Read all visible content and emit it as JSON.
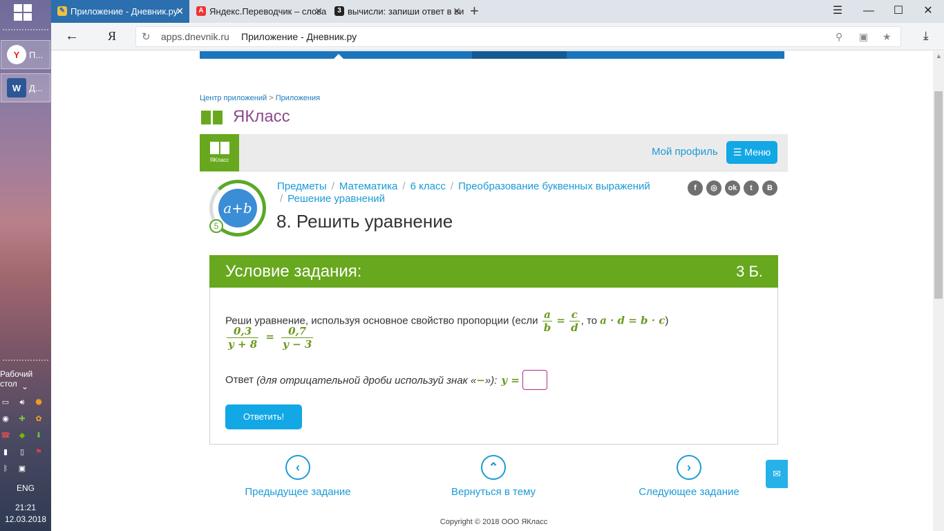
{
  "taskbar": {
    "apps": [
      {
        "label": "П...",
        "icon": "yandex-browser-icon"
      },
      {
        "label": "Д...",
        "icon": "word-icon"
      }
    ],
    "desktop_label": "Рабочий стол",
    "language": "ENG",
    "time": "21:21",
    "date": "12.03.2018"
  },
  "browser": {
    "tabs": [
      {
        "title": "Приложение - Дневник.ру",
        "icon": "dnevnik-icon",
        "active": true
      },
      {
        "title": "Яндекс.Переводчик – слова",
        "icon": "yandex-translate-icon",
        "active": false
      },
      {
        "title": "вычисли: запиши ответ в ви",
        "icon": "znanija-icon",
        "active": false
      }
    ],
    "url_host": "apps.dnevnik.ru",
    "url_title": "Приложение - Дневник.ру",
    "yandex_button": "Я"
  },
  "page": {
    "breadcrumb_top": [
      "Центр приложений",
      "Приложения"
    ],
    "brand_name": "ЯКласс",
    "logo_label": "ЯКласс",
    "my_profile": "Мой профиль",
    "menu_label": "☰ Меню",
    "topic_formula": "a+b",
    "topic_level": "5",
    "crumbs": [
      "Предметы",
      "Математика",
      "6 класс",
      "Преобразование буквенных выражений",
      "Решение уравнений"
    ],
    "title": "8. Решить уравнение",
    "social": [
      "f",
      "◎",
      "ok",
      "t",
      "B"
    ],
    "task": {
      "header": "Условие задания:",
      "points": "3 Б.",
      "text_before": "Реши уравнение, используя основное свойство пропорции (если",
      "frac1_num": "a",
      "frac1_den": "b",
      "eq1": "=",
      "frac2_num": "c",
      "frac2_den": "d",
      "text_mid": ", то",
      "product": "a · d = b · c",
      "text_end": ")",
      "eq_left_num": "0,3",
      "eq_left_den": "y + 8",
      "eq_sign": "=",
      "eq_right_num": "0,7",
      "eq_right_den": "y − 3",
      "answer_label": "Ответ",
      "answer_hint": "(для отрицательной дроби используй знак «",
      "minus_sign": "−",
      "answer_hint_end": "»):",
      "answer_var": "y =",
      "answer_value": "",
      "submit": "Ответить!"
    },
    "nav": {
      "prev": "Предыдущее задание",
      "back": "Вернуться в тему",
      "next": "Следующее задание"
    },
    "copyright": "Copyright © 2018 ООО ЯКласс"
  },
  "colors": {
    "accent_green": "#67a81e",
    "accent_blue": "#12a7e5",
    "brand_purple": "#8c4a8e"
  }
}
